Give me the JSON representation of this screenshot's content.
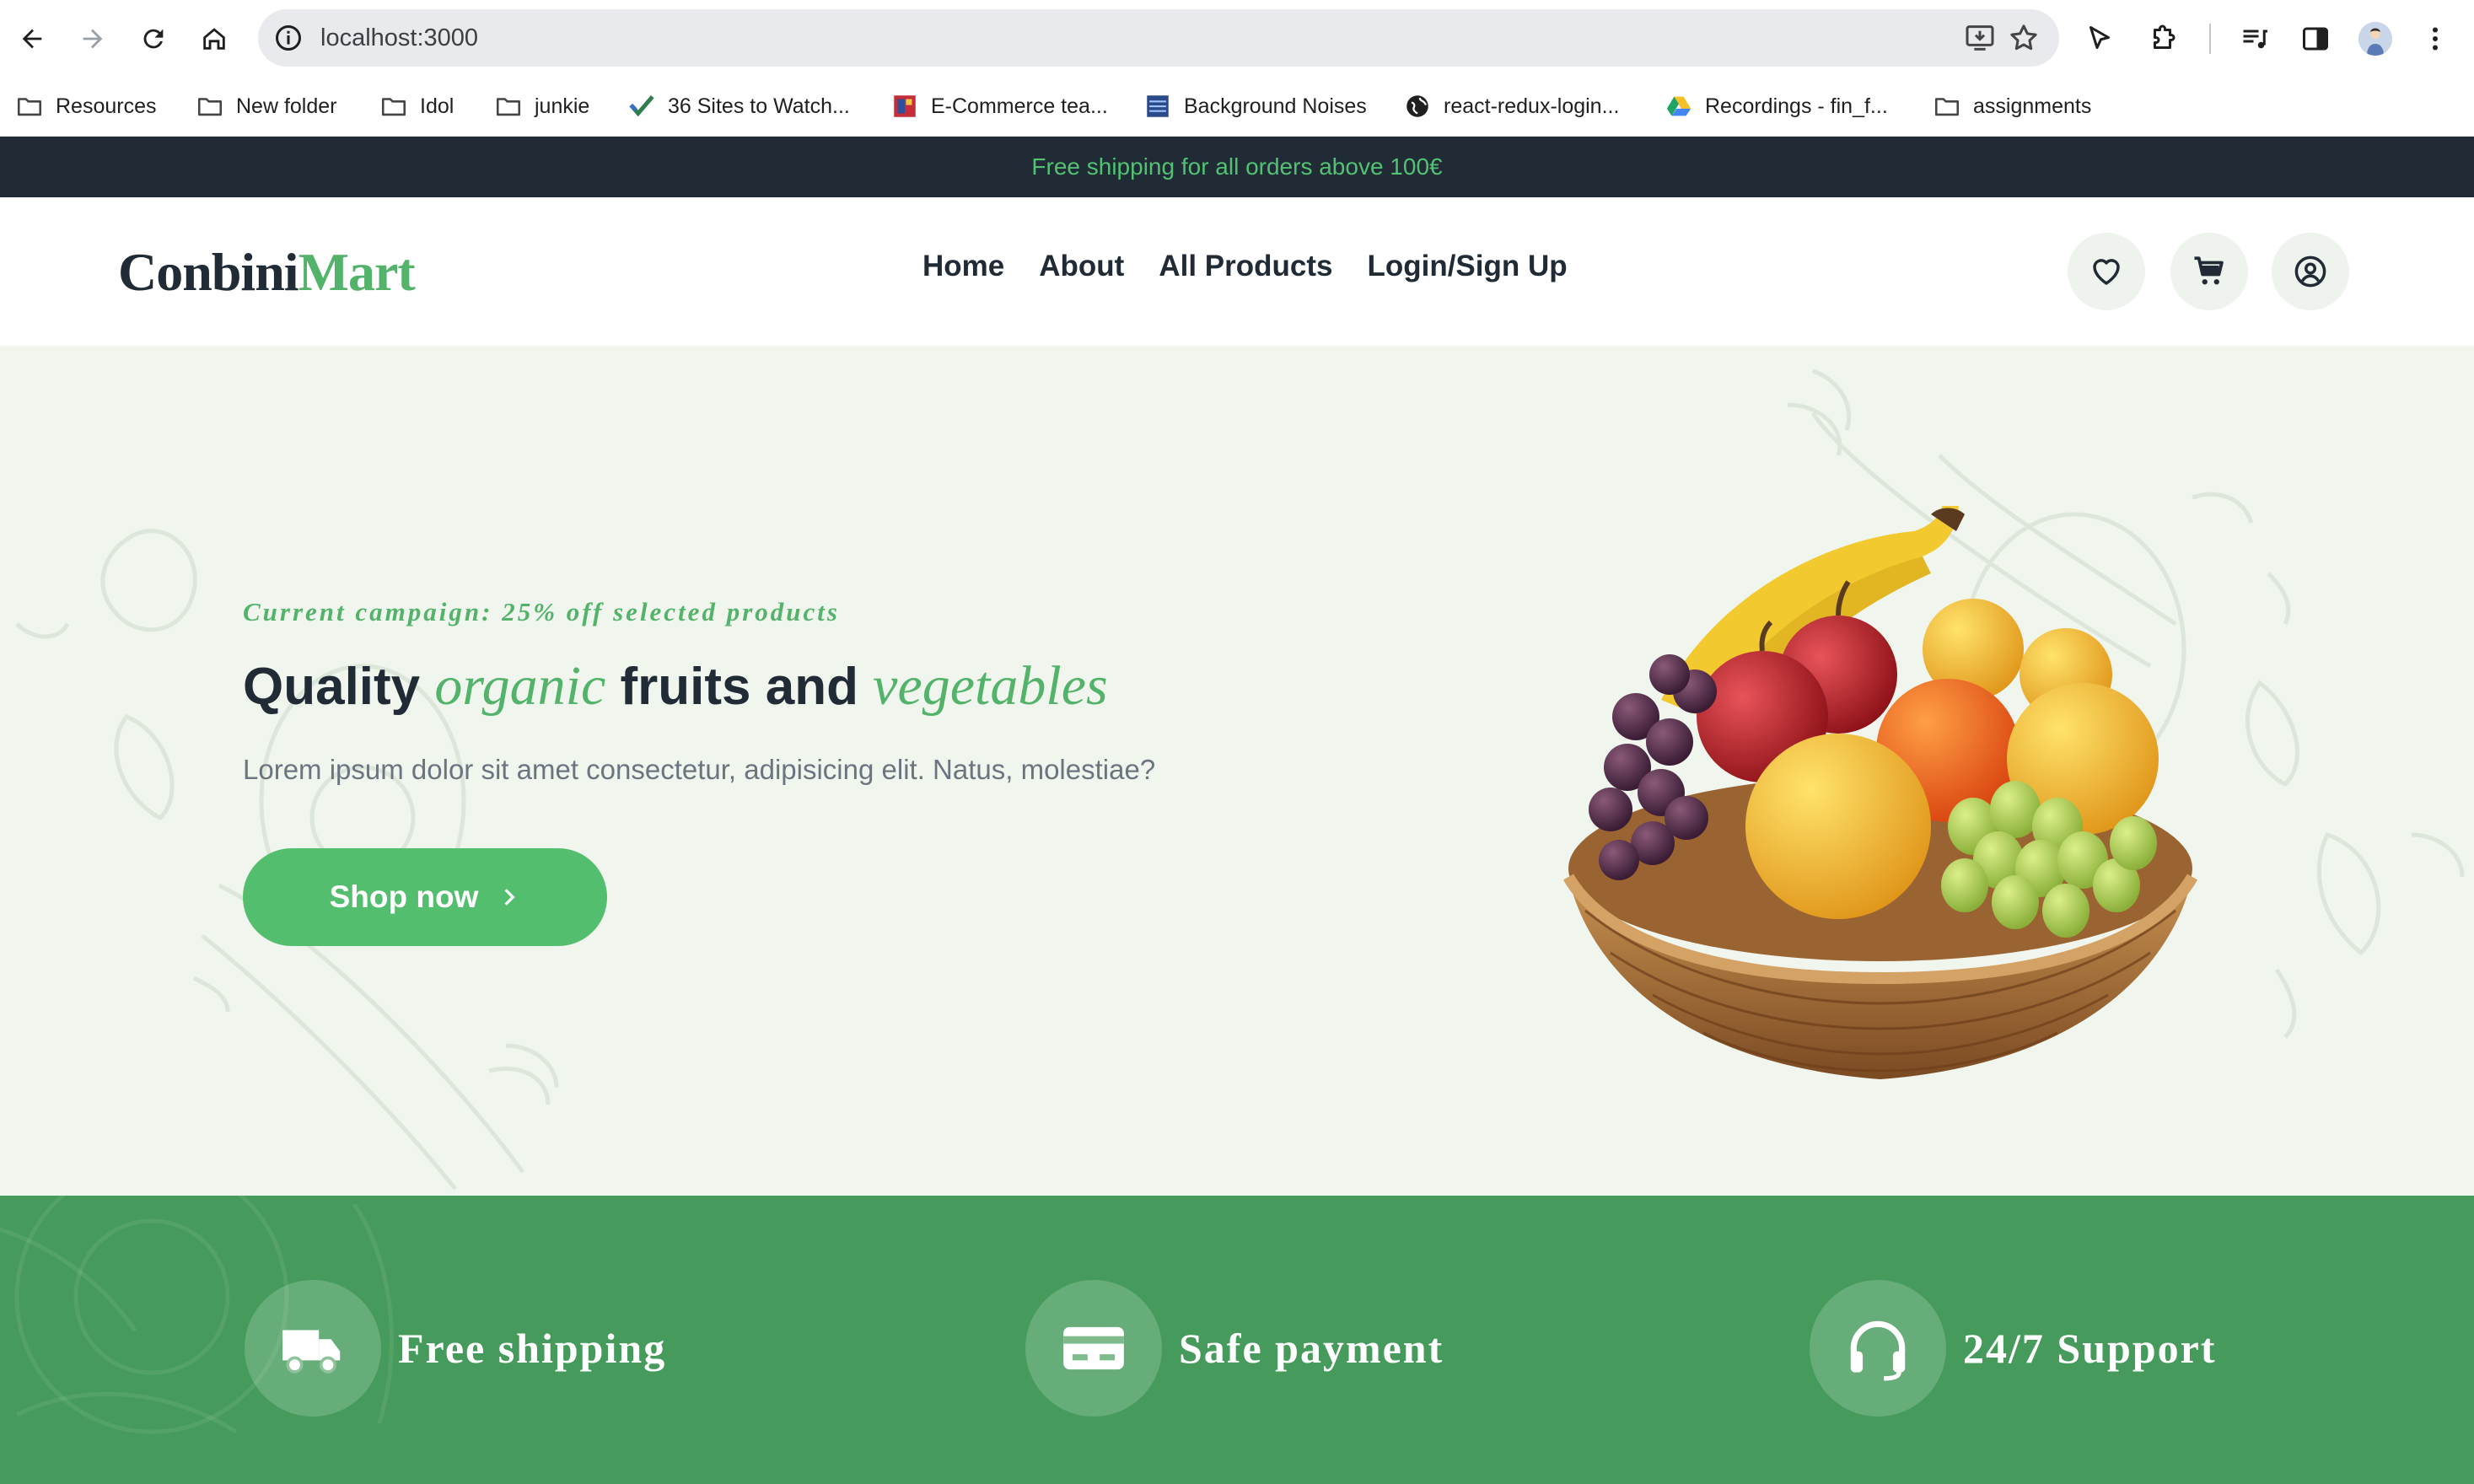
{
  "browser": {
    "url": "localhost:3000",
    "bookmarks": [
      {
        "label": "Resources",
        "icon": "folder-icon"
      },
      {
        "label": "New folder",
        "icon": "folder-icon"
      },
      {
        "label": "Idol",
        "icon": "folder-icon"
      },
      {
        "label": "junkie",
        "icon": "folder-icon"
      },
      {
        "label": "36 Sites to Watch...",
        "icon": "checkmark-favicon"
      },
      {
        "label": "E-Commerce tea...",
        "icon": "ecommerce-favicon"
      },
      {
        "label": "Background Noises",
        "icon": "noise-favicon"
      },
      {
        "label": "react-redux-login...",
        "icon": "globe-icon"
      },
      {
        "label": "Recordings - fin_f...",
        "icon": "drive-icon"
      },
      {
        "label": "assignments",
        "icon": "folder-icon"
      }
    ]
  },
  "promo": {
    "text": "Free shipping for all orders above 100€"
  },
  "header": {
    "logo_part1": "Conbini",
    "logo_part2": "Mart",
    "nav": [
      "Home",
      "About",
      "All Products",
      "Login/Sign Up"
    ],
    "icons": [
      "heart-icon",
      "cart-icon",
      "user-icon"
    ]
  },
  "hero": {
    "campaign": "Current campaign: 25% off selected products",
    "headline": {
      "p1": "Quality ",
      "accent1": "organic",
      "p2": " fruits and ",
      "accent2": "vegetables"
    },
    "subtext": "Lorem ipsum dolor sit amet consectetur, adipisicing elit. Natus, molestiae?",
    "cta": "Shop now"
  },
  "features": [
    {
      "label": "Free shipping",
      "icon": "truck-icon"
    },
    {
      "label": "Safe payment",
      "icon": "credit-card-icon"
    },
    {
      "label": "24/7 Support",
      "icon": "headset-icon"
    }
  ],
  "colors": {
    "brand_green": "#53b36b",
    "dark": "#212b36",
    "hero_bg": "#f0f5ed",
    "feature_bg": "#469b5c"
  }
}
